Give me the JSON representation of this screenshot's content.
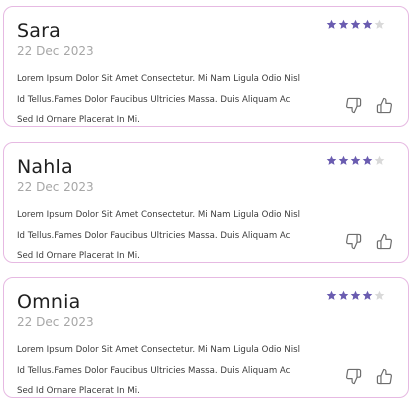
{
  "colors": {
    "card_border": "#e6b9e2",
    "star_filled": "#6a5cb0",
    "star_empty": "#d9d9d9",
    "icon": "#6e6e6e"
  },
  "reviews": [
    {
      "name": "Sara",
      "date": "22 Dec 2023",
      "rating": 4,
      "rating_max": 5,
      "text_lines": [
        "Lorem Ipsum Dolor Sit Amet Consectetur. Mi Nam Ligula Odio Nisl",
        "Id Tellus.Fames Dolor Faucibus Ultricies Massa. Duis Aliquam Ac",
        "Sed Id Ornare Placerat In Mi."
      ]
    },
    {
      "name": "Nahla",
      "date": "22 Dec 2023",
      "rating": 4,
      "rating_max": 5,
      "text_lines": [
        "Lorem Ipsum Dolor Sit Amet Consectetur. Mi Nam Ligula Odio Nisl",
        "Id Tellus.Fames Dolor Faucibus Ultricies Massa. Duis Aliquam Ac",
        "Sed Id Ornare Placerat In Mi."
      ]
    },
    {
      "name": "Omnia",
      "date": "22 Dec 2023",
      "rating": 4,
      "rating_max": 5,
      "text_lines": [
        "Lorem Ipsum Dolor Sit Amet Consectetur. Mi Nam Ligula Odio Nisl",
        "Id Tellus.Fames Dolor Faucibus Ultricies Massa. Duis Aliquam Ac",
        "Sed Id Ornare Placerat In Mi."
      ]
    }
  ],
  "icons": {
    "dislike": "thumbs-down-icon",
    "like": "thumbs-up-icon"
  }
}
